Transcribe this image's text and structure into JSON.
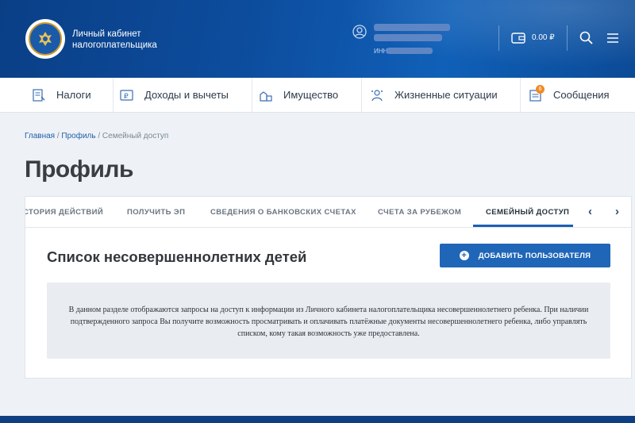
{
  "header": {
    "logo_line1": "Личный кабинет",
    "logo_line2": "налогоплательщика",
    "inn_label": "ИНН",
    "balance": "0.00 ₽",
    "icons": [
      "emblem-icon",
      "user-icon",
      "wallet-icon",
      "search-icon",
      "menu-icon"
    ]
  },
  "nav": {
    "items": [
      {
        "label": "Налоги",
        "icon": "taxes-icon"
      },
      {
        "label": "Доходы и вычеты",
        "icon": "income-icon"
      },
      {
        "label": "Имущество",
        "icon": "property-icon"
      },
      {
        "label": "Жизненные ситуации",
        "icon": "life-situations-icon"
      },
      {
        "label": "Сообщения",
        "icon": "messages-icon",
        "badge": "6"
      }
    ]
  },
  "breadcrumb": {
    "home": "Главная",
    "sep": " / ",
    "profile": "Профиль",
    "current": "Семейный доступ"
  },
  "page_title": "Профиль",
  "tabs": [
    {
      "label": "СТОРИЯ ДЕЙСТВИЙ"
    },
    {
      "label": "ПОЛУЧИТЬ ЭП"
    },
    {
      "label": "СВЕДЕНИЯ О БАНКОВСКИХ СЧЕТАХ"
    },
    {
      "label": "СЧЕТА ЗА РУБЕЖОМ"
    },
    {
      "label": "СЕМЕЙНЫЙ ДОСТУП",
      "active": true
    }
  ],
  "section": {
    "title": "Список несовершеннолетних детей",
    "add_button": "ДОБАВИТЬ ПОЛЬЗОВАТЕЛЯ",
    "info_text": "В данном разделе отображаются запросы на доступ к информации из Личного кабинета налогоплательщика несовершеннолетнего ребенка. При наличии подтвержденного запроса Вы получите возможность просматривать и оплачивать платёжные документы несовершеннолетнего ребенка, либо управлять списком, кому такая возможность уже предоставлена."
  },
  "colors": {
    "header_bg": "#0d4d9e",
    "accent": "#1f66b8",
    "badge": "#f08a24"
  }
}
